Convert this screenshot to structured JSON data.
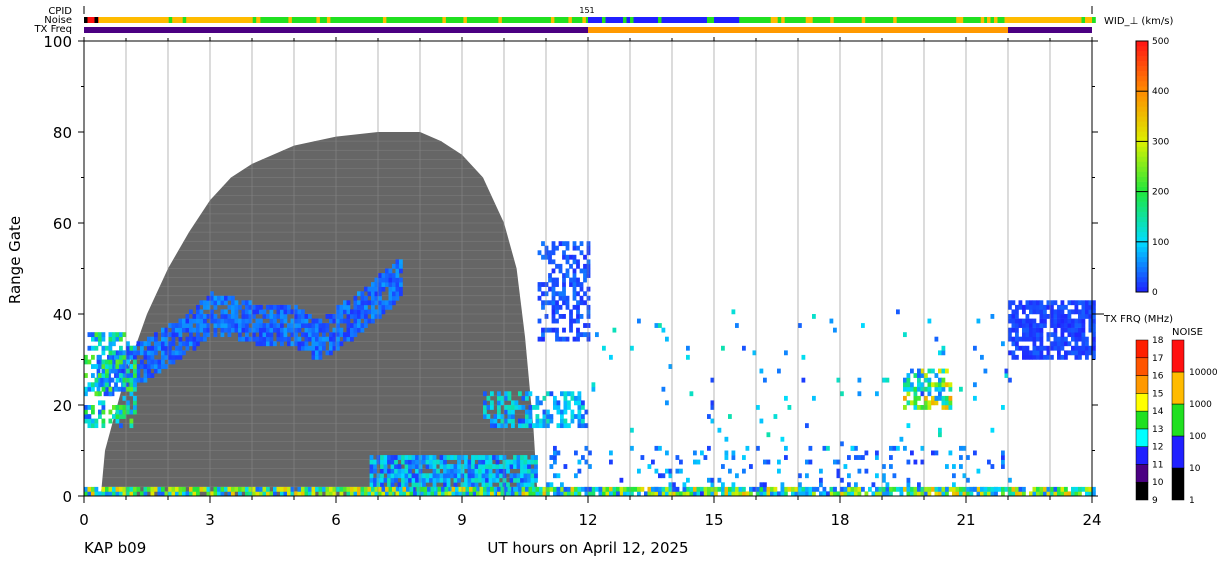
{
  "chart_data": {
    "type": "heatmap",
    "station_label": "KAP b09",
    "xlabel": "UT hours on April 12, 2025",
    "ylabel": "Range Gate",
    "xlim": [
      0,
      24
    ],
    "ylim": [
      0,
      100
    ],
    "x_ticks": [
      "0",
      "3",
      "6",
      "9",
      "12",
      "15",
      "18",
      "21",
      "24"
    ],
    "y_ticks": [
      "0",
      "20",
      "40",
      "60",
      "80",
      "100"
    ],
    "header_rows": {
      "cpid_label": "CPID",
      "noise_label": "Noise",
      "txfreq_label": "TX Freq",
      "cpid_value": "151",
      "cpid_change_hours": [
        0,
        12,
        24
      ]
    },
    "noise_segments": [
      {
        "t0": 0,
        "t1": 0.35,
        "level": "10000+"
      },
      {
        "t0": 0.35,
        "t1": 4.2,
        "level": "1000-10000"
      },
      {
        "t0": 4.2,
        "t1": 12,
        "level": "100-1000"
      },
      {
        "t0": 12,
        "t1": 15.6,
        "level": "10-100"
      },
      {
        "t0": 15.6,
        "t1": 21.5,
        "level": "100-1000"
      },
      {
        "t0": 21.5,
        "t1": 24,
        "level": "1000-10000"
      }
    ],
    "txfreq_segments": [
      {
        "t0": 0,
        "t1": 12,
        "mhz": 10.5
      },
      {
        "t0": 12,
        "t1": 22,
        "mhz": 15.5
      },
      {
        "t0": 22,
        "t1": 24,
        "mhz": 10.5
      }
    ],
    "ground_scatter_upper_gate": [
      [
        0.4,
        0
      ],
      [
        0.5,
        10
      ],
      [
        1,
        27
      ],
      [
        1.5,
        40
      ],
      [
        2,
        50
      ],
      [
        2.5,
        58
      ],
      [
        3,
        65
      ],
      [
        3.5,
        70
      ],
      [
        4,
        73
      ],
      [
        5,
        77
      ],
      [
        6,
        79
      ],
      [
        7,
        80
      ],
      [
        8,
        80
      ],
      [
        8.5,
        78
      ],
      [
        9,
        75
      ],
      [
        9.5,
        70
      ],
      [
        10,
        60
      ],
      [
        10.3,
        50
      ],
      [
        10.5,
        35
      ],
      [
        10.7,
        15
      ],
      [
        10.8,
        0
      ]
    ],
    "echo_regions": [
      {
        "name": "main-band",
        "path": [
          [
            0.3,
            26
          ],
          [
            1,
            28
          ],
          [
            1.5,
            30
          ],
          [
            2.5,
            36
          ],
          [
            3,
            40
          ],
          [
            4,
            38
          ],
          [
            5,
            37
          ],
          [
            5.5,
            34
          ],
          [
            6,
            37
          ],
          [
            6.5,
            40
          ],
          [
            7,
            44
          ],
          [
            7.5,
            48
          ]
        ],
        "halfwidth": 4,
        "width_kms": 30,
        "density": 0.8
      },
      {
        "name": "low-gates-night",
        "t": [
          6.8,
          10.8
        ],
        "g": [
          0,
          8
        ],
        "width_kms": 60,
        "density": 0.85
      },
      {
        "name": "dawn-low",
        "t": [
          9.5,
          12
        ],
        "g": [
          15,
          22
        ],
        "width_kms": 60,
        "density": 0.6
      },
      {
        "name": "dawn-high",
        "t": [
          10.8,
          12
        ],
        "g": [
          34,
          55
        ],
        "width_kms": 20,
        "density": 0.5
      },
      {
        "name": "early-low",
        "t": [
          0,
          1.2
        ],
        "g": [
          15,
          35
        ],
        "width_kms": 100,
        "density": 0.5
      },
      {
        "name": "evening",
        "t": [
          22,
          24
        ],
        "g": [
          30,
          42
        ],
        "width_kms": 15,
        "density": 0.75
      },
      {
        "name": "afternoon-patch",
        "t": [
          19.5,
          20.6
        ],
        "g": [
          19,
          27
        ],
        "width_kms": 160,
        "density": 0.6
      },
      {
        "name": "near-range",
        "t": [
          0,
          24
        ],
        "g": [
          0,
          1
        ],
        "width_kms": 150,
        "density": 0.9
      },
      {
        "name": "sparse-day",
        "t": [
          11,
          22
        ],
        "g": [
          0,
          10
        ],
        "width_kms": 40,
        "density": 0.12
      },
      {
        "name": "sparse-mid",
        "t": [
          12,
          22
        ],
        "g": [
          10,
          40
        ],
        "width_kms": 60,
        "density": 0.02
      }
    ],
    "colorbars": {
      "width": {
        "title": "WID_⊥ (km/s)",
        "ticks": [
          "0",
          "100",
          "200",
          "300",
          "400",
          "500"
        ],
        "range": [
          0,
          500
        ]
      },
      "txfreq": {
        "title": "TX FRQ (MHz)",
        "ticks": [
          "9",
          "10",
          "11",
          "12",
          "13",
          "14",
          "15",
          "16",
          "17",
          "18"
        ],
        "colors": [
          "#000000",
          "#4b0082",
          "#2020ff",
          "#00ffff",
          "#20e020",
          "#ffff00",
          "#ff9900",
          "#ff5500",
          "#ff2000"
        ]
      },
      "noise": {
        "title": "NOISE",
        "ticks": [
          "1",
          "10",
          "100",
          "1000",
          "10000"
        ],
        "colors": [
          "#000000",
          "#2020ff",
          "#20e020",
          "#ffbb00",
          "#ff1010"
        ]
      }
    },
    "ground_scatter_color": "#666666"
  }
}
